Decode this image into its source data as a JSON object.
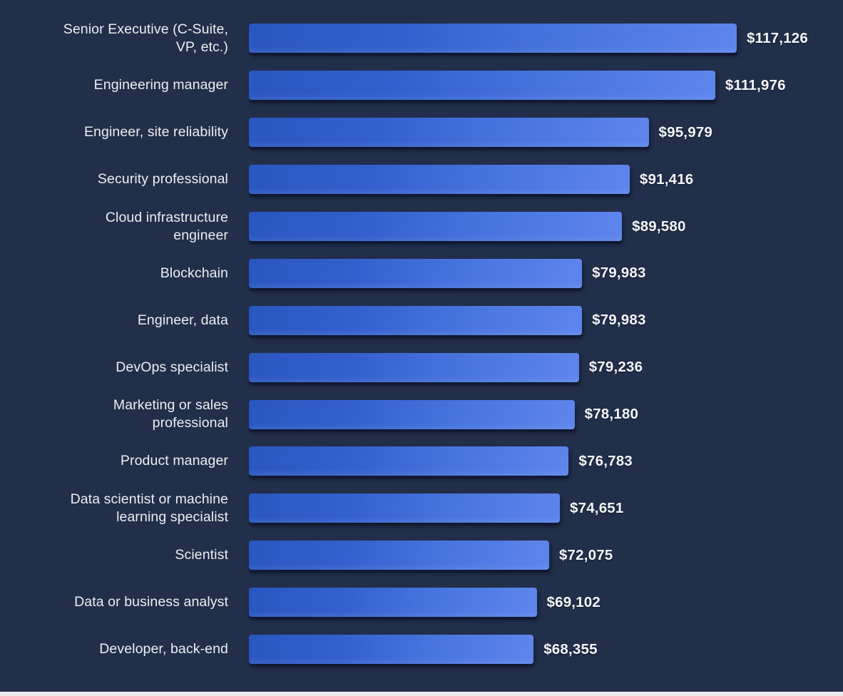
{
  "theme": {
    "background": "#222f4b",
    "bar_gradient_start": "#2a56bf",
    "bar_gradient_end": "#5d85ec",
    "label_color": "#eceef1",
    "value_color": "#f4f5f7",
    "bottom_edge_color": "#e9eaec"
  },
  "chart_data": {
    "type": "bar",
    "orientation": "horizontal",
    "title": "",
    "subtitle": "",
    "xlabel": "",
    "ylabel": "",
    "grid": false,
    "legend": "none",
    "axis_visible": false,
    "value_prefix": "$",
    "xlim": [
      0,
      117126
    ],
    "categories": [
      "Senior Executive (C-Suite, VP, etc.)",
      "Engineering manager",
      "Engineer, site reliability",
      "Security professional",
      "Cloud infrastructure engineer",
      "Blockchain",
      "Engineer, data",
      "DevOps specialist",
      "Marketing or sales professional",
      "Product manager",
      "Data scientist or machine learning specialist",
      "Scientist",
      "Data or business analyst",
      "Developer, back-end"
    ],
    "values": [
      117126,
      111976,
      95979,
      91416,
      89580,
      79983,
      79983,
      79236,
      78180,
      76783,
      74651,
      72075,
      69102,
      68355
    ],
    "value_labels": [
      "$117,126",
      "$111,976",
      "$95,979",
      "$91,416",
      "$89,580",
      "$79,983",
      "$79,983",
      "$79,236",
      "$78,180",
      "$76,783",
      "$74,651",
      "$72,075",
      "$69,102",
      "$68,355"
    ],
    "category_lines": [
      "Senior Executive (C-Suite,\nVP, etc.)",
      "Engineering manager",
      "Engineer, site reliability",
      "Security professional",
      "Cloud infrastructure\nengineer",
      "Blockchain",
      "Engineer, data",
      "DevOps specialist",
      "Marketing or sales\nprofessional",
      "Product manager",
      "Data scientist or machine\nlearning specialist",
      "Scientist",
      "Data or business analyst",
      "Developer, back-end"
    ]
  }
}
